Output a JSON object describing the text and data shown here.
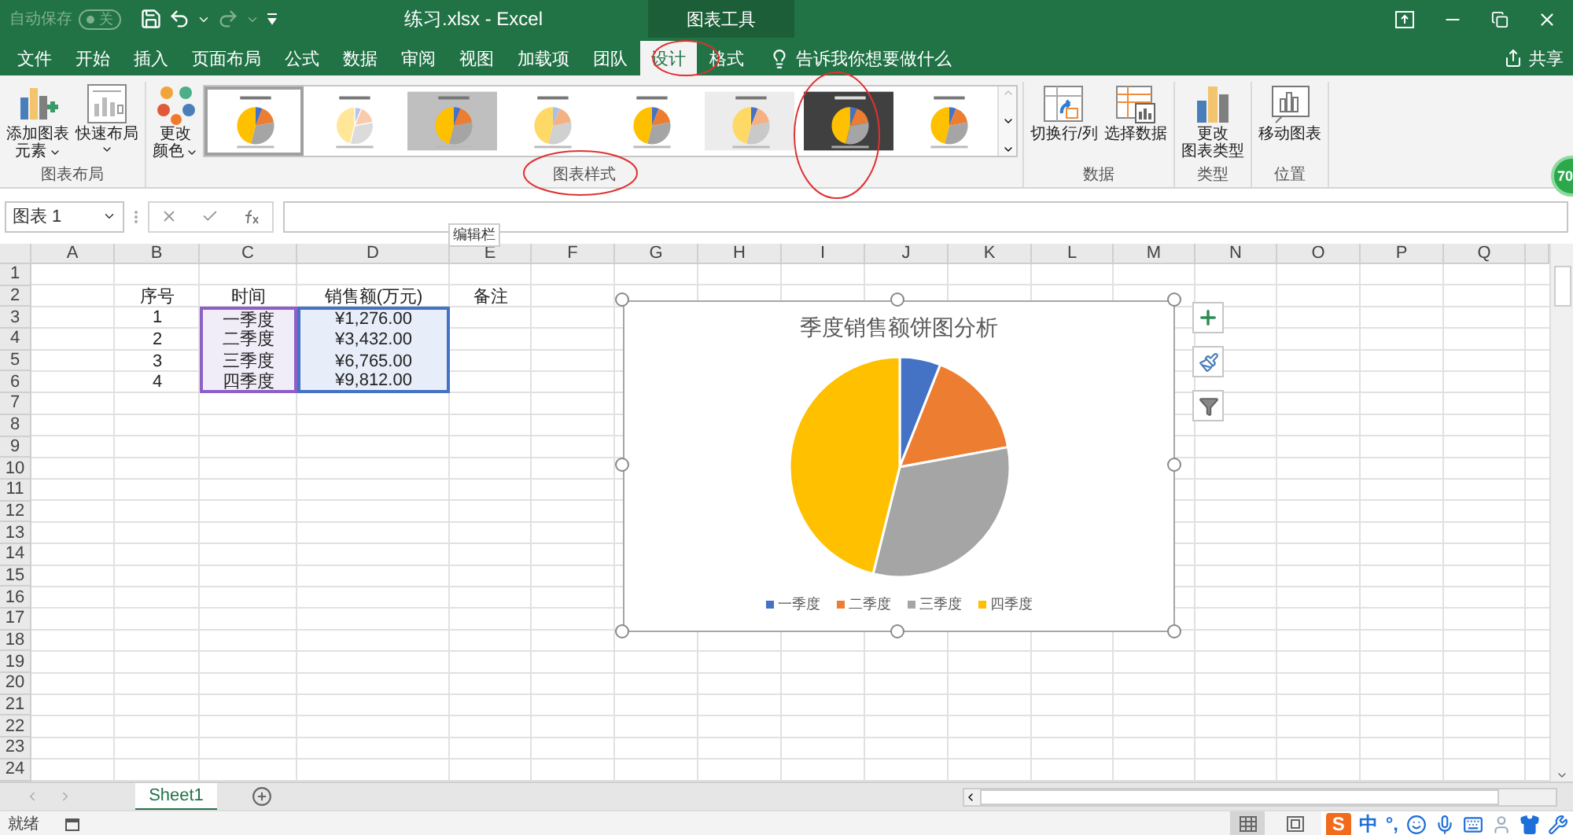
{
  "quick_access": {
    "autosave_label": "自动保存",
    "autosave_toggle": {
      "text": "关",
      "on": false
    }
  },
  "window": {
    "title": "练习.xlsx  -  Excel",
    "context_group": "图表工具"
  },
  "ribbon_tabs": [
    {
      "label": "文件",
      "selected": false
    },
    {
      "label": "开始",
      "selected": false
    },
    {
      "label": "插入",
      "selected": false
    },
    {
      "label": "页面布局",
      "selected": false
    },
    {
      "label": "公式",
      "selected": false
    },
    {
      "label": "数据",
      "selected": false
    },
    {
      "label": "审阅",
      "selected": false
    },
    {
      "label": "视图",
      "selected": false
    },
    {
      "label": "加载项",
      "selected": false
    },
    {
      "label": "团队",
      "selected": false
    },
    {
      "label": "设计",
      "selected": true
    },
    {
      "label": "格式",
      "selected": false
    }
  ],
  "tell_me": {
    "placeholder": "告诉我你想要做什么"
  },
  "share": "共享",
  "ribbon_groups": [
    {
      "label": "图表布局",
      "buttons": [
        {
          "kind": "add-element",
          "lines": [
            "添加图表",
            "元素"
          ],
          "dropdown": true
        },
        {
          "kind": "quick-layout",
          "lines": [
            "快速布局"
          ],
          "dropdown": true
        }
      ]
    },
    {
      "label": "图表样式",
      "buttons": [
        {
          "kind": "change-colors",
          "lines": [
            "更改",
            "颜色"
          ],
          "dropdown": true
        }
      ],
      "gallery": [
        {
          "kind": "plain",
          "selected": true
        },
        {
          "kind": "hatched",
          "selected": false
        },
        {
          "kind": "gradient",
          "selected": false
        },
        {
          "kind": "pastel",
          "selected": false
        },
        {
          "kind": "plain",
          "selected": false
        },
        {
          "kind": "hatched-background",
          "selected": false
        },
        {
          "kind": "dark",
          "selected": false
        },
        {
          "kind": "labels",
          "selected": false
        }
      ]
    },
    {
      "label": "数据",
      "buttons": [
        {
          "kind": "switch-row-column",
          "lines": [
            "切换行/列"
          ],
          "dropdown": false
        },
        {
          "kind": "select-data",
          "lines": [
            "选择数据"
          ],
          "dropdown": false
        }
      ]
    },
    {
      "label": "类型",
      "buttons": [
        {
          "kind": "change-type",
          "lines": [
            "更改",
            "图表类型"
          ],
          "dropdown": false
        }
      ]
    },
    {
      "label": "位置",
      "buttons": [
        {
          "kind": "move-chart",
          "lines": [
            "移动图表"
          ],
          "dropdown": false
        }
      ]
    }
  ],
  "zoom_badge": "70",
  "formula_bar": {
    "name_box": "图表 1",
    "tooltip": "编辑栏"
  },
  "sheet": {
    "columns": [
      "A",
      "B",
      "C",
      "D",
      "E",
      "F",
      "G",
      "H",
      "I",
      "J",
      "K",
      "L",
      "M",
      "N",
      "O",
      "P",
      "Q"
    ],
    "row_numbers": [
      "1",
      "2",
      "3",
      "4",
      "5",
      "6",
      "7",
      "8",
      "9",
      "10",
      "11",
      "12",
      "13",
      "14",
      "15",
      "16",
      "17",
      "18",
      "19",
      "20",
      "21",
      "22",
      "23",
      "24"
    ],
    "data_rows": [
      {
        "cells": [
          "序号",
          "时间",
          "销售额(万元)",
          "备注"
        ],
        "in_chart": false
      },
      {
        "cells": [
          "1",
          "一季度",
          "¥1,276.00"
        ],
        "in_chart": true
      },
      {
        "cells": [
          "2",
          "二季度",
          "¥3,432.00"
        ],
        "in_chart": true
      },
      {
        "cells": [
          "3",
          "三季度",
          "¥6,765.00"
        ],
        "in_chart": true
      },
      {
        "cells": [
          "4",
          "四季度",
          "¥9,812.00"
        ],
        "in_chart": true
      }
    ]
  },
  "chart": {
    "legend": [
      {
        "color": "#4472c4"
      },
      {
        "color": "#ed7d31"
      },
      {
        "color": "#a5a5a5"
      },
      {
        "color": "#ffc000"
      }
    ],
    "chart_data": {
      "type": "pie",
      "title": "季度销售额饼图分析",
      "categories": [
        "一季度",
        "二季度",
        "三季度",
        "四季度"
      ],
      "values": [
        6.0,
        16.1,
        31.8,
        46.1
      ]
    }
  },
  "sheet_tabs": [
    {
      "label": "Sheet1",
      "selected": true
    }
  ],
  "status_bar": {
    "text": "就绪",
    "views": [
      {
        "kind": "normal",
        "selected": true
      },
      {
        "kind": "page-layout",
        "selected": false
      }
    ]
  },
  "ime_toolbar": {
    "logo": "S",
    "mode": "中",
    "punctuation": "°,"
  }
}
